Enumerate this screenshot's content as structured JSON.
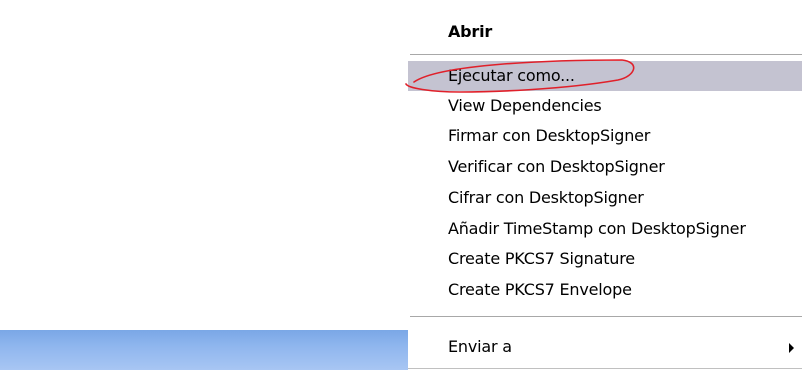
{
  "context_menu": {
    "items": [
      {
        "label": "Abrir",
        "bold": true
      },
      {
        "label": "Ejecutar como...",
        "highlighted": true
      },
      {
        "label": "View Dependencies"
      },
      {
        "label": "Firmar con DesktopSigner"
      },
      {
        "label": "Verificar con DesktopSigner"
      },
      {
        "label": "Cifrar con DesktopSigner"
      },
      {
        "label": "Añadir TimeStamp con DesktopSigner"
      },
      {
        "label": "Create PKCS7 Signature"
      },
      {
        "label": "Create PKCS7 Envelope"
      },
      {
        "label": "Enviar a",
        "has_submenu": true
      }
    ],
    "highlight_color": "#c4c3d1",
    "annotation_color": "#e0202a"
  },
  "desktop": {
    "taskbar_color": "#8fb6ee"
  }
}
